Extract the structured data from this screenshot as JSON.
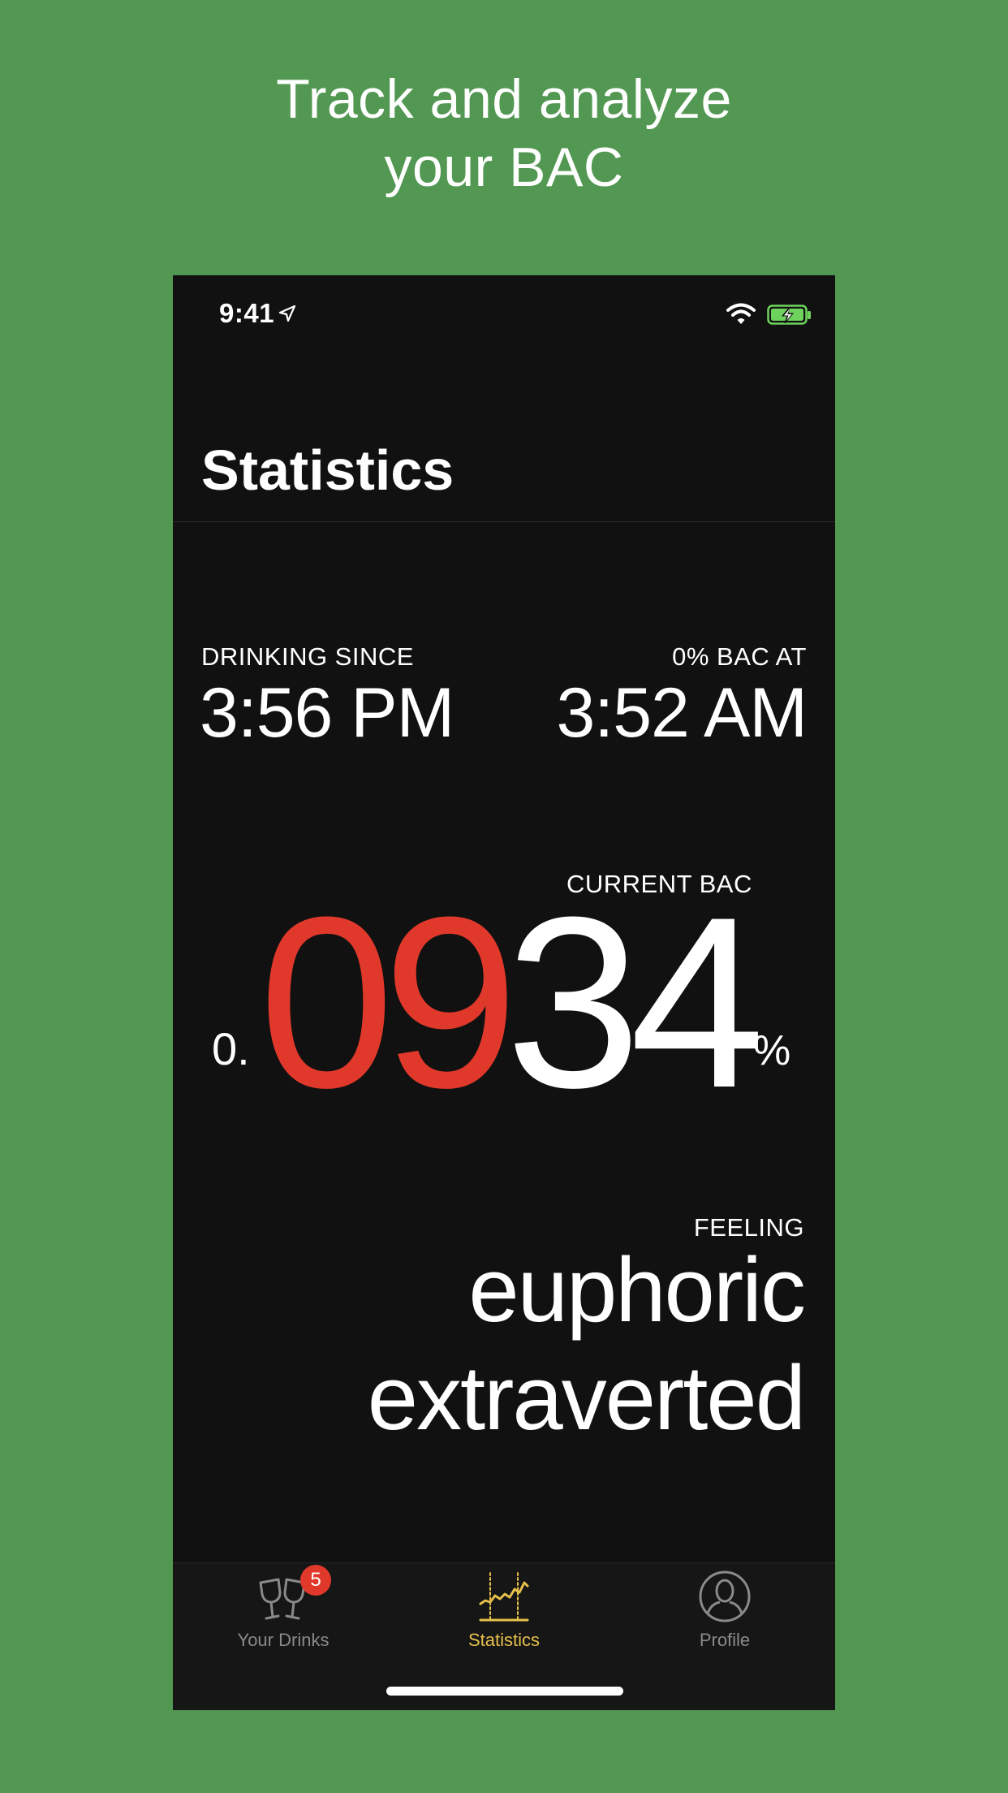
{
  "promo": {
    "headline_line1": "Track and analyze",
    "headline_line2": "your BAC"
  },
  "status_bar": {
    "time": "9:41"
  },
  "nav": {
    "title": "Statistics"
  },
  "stats": {
    "drinking_since_label": "DRINKING SINCE",
    "drinking_since_value": "3:56 PM",
    "zero_bac_label": "0% BAC AT",
    "zero_bac_value": "3:52 AM",
    "current_bac_label": "CURRENT BAC",
    "bac_prefix": "0.",
    "bac_highlight": "09",
    "bac_rest": "34",
    "bac_unit": "%",
    "feeling_label": "FEELING",
    "feeling_words": [
      "euphoric",
      "extraverted"
    ]
  },
  "tabs": [
    {
      "label": "Your Drinks",
      "icon": "glasses-icon",
      "badge": "5"
    },
    {
      "label": "Statistics",
      "icon": "chart-icon"
    },
    {
      "label": "Profile",
      "icon": "profile-icon"
    }
  ],
  "colors": {
    "background": "#539852",
    "screen": "#111111",
    "accent_red": "#e0392b",
    "active_tab": "#e6c04a",
    "inactive_tab": "#8a8a8a"
  }
}
